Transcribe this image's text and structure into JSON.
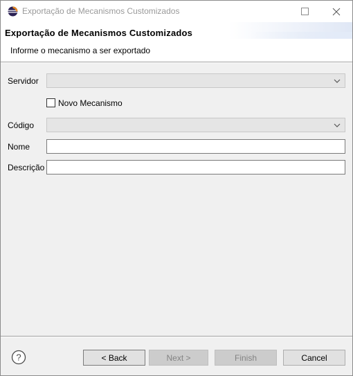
{
  "window": {
    "title": "Exportação de Mecanismos Customizados",
    "icon": "eclipse-icon"
  },
  "header": {
    "title": "Exportação de Mecanismos Customizados",
    "subtitle": "Informe o mecanismo a ser exportado"
  },
  "form": {
    "servidor_label": "Servidor",
    "servidor_value": "",
    "novo_mecanismo_label": "Novo Mecanismo",
    "novo_mecanismo_checked": false,
    "codigo_label": "Código",
    "codigo_value": "",
    "nome_label": "Nome",
    "nome_value": "",
    "descricao_label": "Descrição",
    "descricao_value": ""
  },
  "footer": {
    "help_icon": "help-icon",
    "back_label": "< Back",
    "next_label": "Next >",
    "finish_label": "Finish",
    "cancel_label": "Cancel"
  },
  "colors": {
    "dialog_bg": "#f0f0f0",
    "disabled_button_bg": "#cccccc",
    "disabled_text": "#838383"
  }
}
